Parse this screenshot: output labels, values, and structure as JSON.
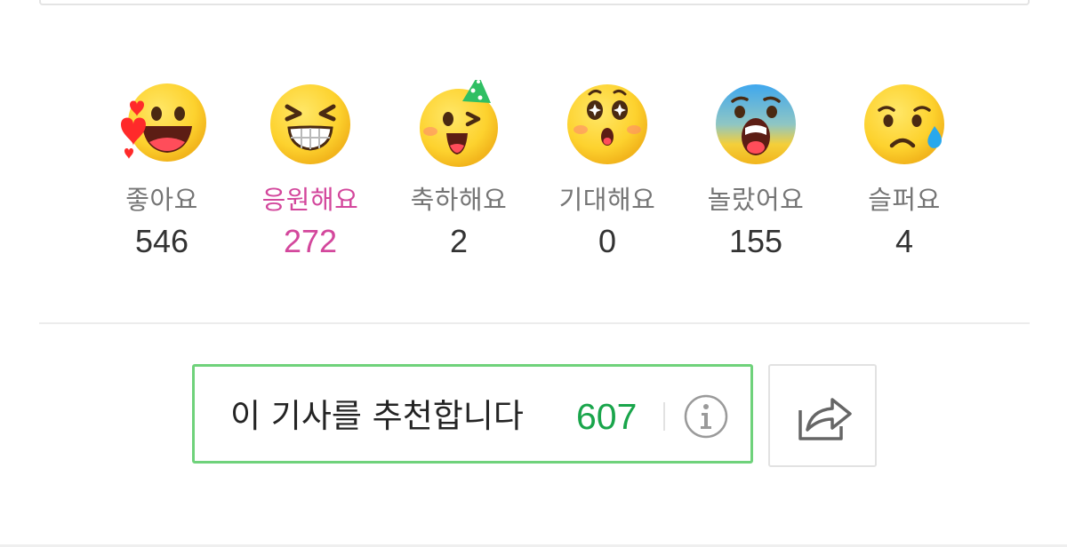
{
  "reactions": [
    {
      "label": "좋아요",
      "count": "546",
      "icon": "love-face-icon"
    },
    {
      "label": "응원해요",
      "count": "272",
      "icon": "cheer-face-icon",
      "selected": true
    },
    {
      "label": "축하해요",
      "count": "2",
      "icon": "party-face-icon"
    },
    {
      "label": "기대해요",
      "count": "0",
      "icon": "expect-face-icon"
    },
    {
      "label": "놀랐어요",
      "count": "155",
      "icon": "shocked-face-icon"
    },
    {
      "label": "슬퍼요",
      "count": "4",
      "icon": "sad-face-icon"
    }
  ],
  "recommend": {
    "label": "이 기사를 추천합니다",
    "count": "607",
    "info_icon": "info-icon"
  },
  "share": {
    "icon": "share-icon"
  },
  "colors": {
    "selected_reaction": "#d3479c",
    "recommend_accent": "#19a54b",
    "recommend_border": "#6fd27b",
    "emoji_yellow": "#fdd22e"
  }
}
